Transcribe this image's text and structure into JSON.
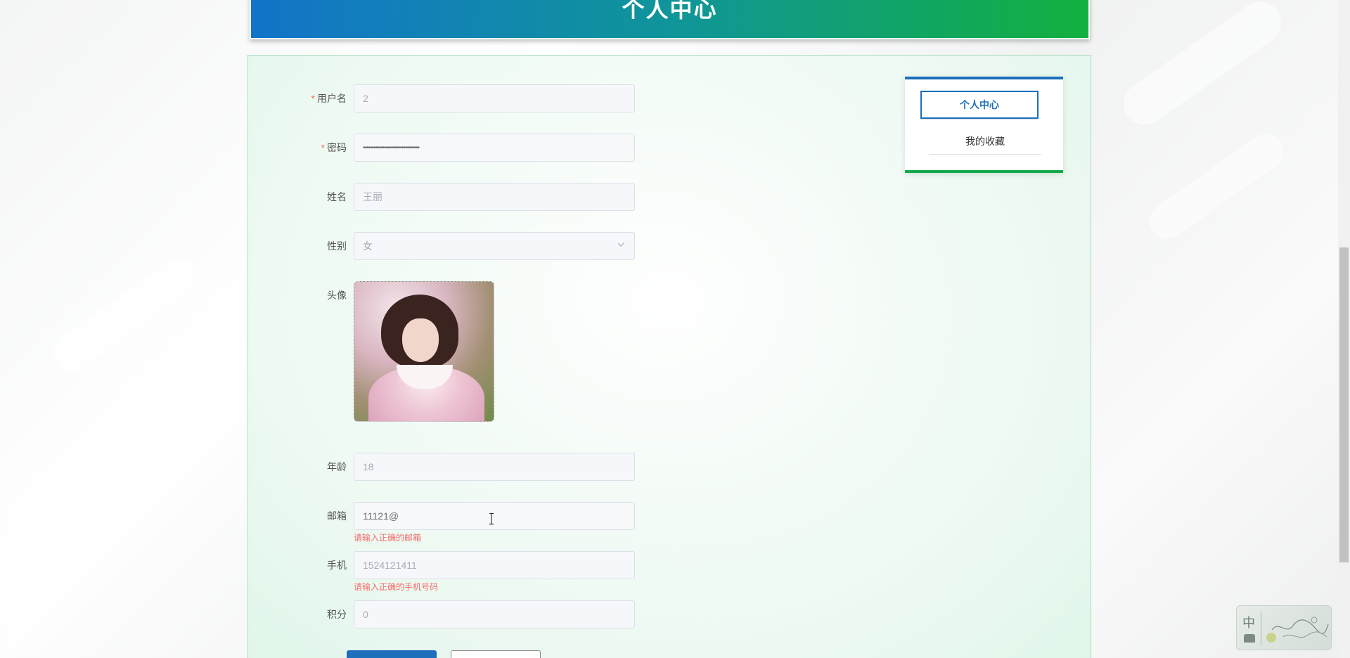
{
  "header": {
    "title": "个人中心"
  },
  "form": {
    "username": {
      "label": "用户名",
      "required_mark": "*",
      "value": "2"
    },
    "password": {
      "label": "密码",
      "required_mark": "*",
      "value": "••••••••••••••••••••••••••••••••"
    },
    "name": {
      "label": "姓名",
      "value": "王丽"
    },
    "gender": {
      "label": "性别",
      "value": "女"
    },
    "avatar": {
      "label": "头像"
    },
    "age": {
      "label": "年龄",
      "value": "18"
    },
    "email": {
      "label": "邮箱",
      "value": "11121@",
      "error": "请输入正确的邮箱"
    },
    "phone": {
      "label": "手机",
      "value": "1524121411",
      "error": "请输入正确的手机号码"
    },
    "points": {
      "label": "积分",
      "value": "0"
    }
  },
  "sidebar": {
    "items": [
      {
        "label": "个人中心",
        "active": true
      },
      {
        "label": "我的收藏",
        "active": false
      }
    ]
  },
  "ime": {
    "mode_char": "中"
  },
  "colors": {
    "primary": "#1d6fbc",
    "accent_green": "#13a94a",
    "error": "#f56c6c"
  }
}
